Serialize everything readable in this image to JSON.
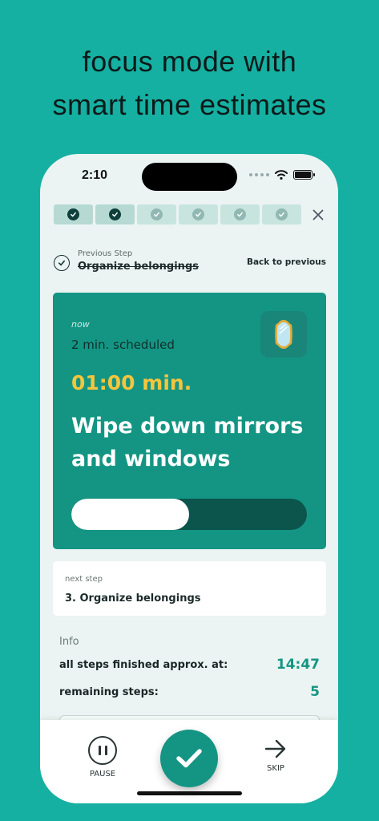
{
  "headline": {
    "line1": "focus mode with",
    "line2": "smart time estimates"
  },
  "status_bar": {
    "time": "2:10",
    "icons": [
      "signal-dots-icon",
      "wifi-icon",
      "battery-icon"
    ]
  },
  "progress": {
    "completed_steps": 2,
    "total_steps": 6,
    "close_icon": "close-icon"
  },
  "previous_step": {
    "label": "Previous Step",
    "title": "Organize belongings",
    "back_label": "Back to previous"
  },
  "current_step": {
    "now_label": "now",
    "scheduled": "2 min. scheduled",
    "timer": "01:00 min.",
    "title": "Wipe down mirrors and windows",
    "icon": "mirror-icon",
    "progress_fraction": 0.5
  },
  "next_step": {
    "label": "next step",
    "title": "3. Organize belongings"
  },
  "info": {
    "title": "Info",
    "finished_label": "all steps finished approx. at:",
    "finished_value": "14:47",
    "remaining_label": "remaining steps:",
    "remaining_value": "5"
  },
  "tabbar": {
    "pause_label": "PAUSE",
    "skip_label": "SKIP",
    "done_icon": "checkmark-icon"
  },
  "colors": {
    "background": "#15b0a1",
    "accent": "#149584",
    "timer": "#f5c53d"
  }
}
